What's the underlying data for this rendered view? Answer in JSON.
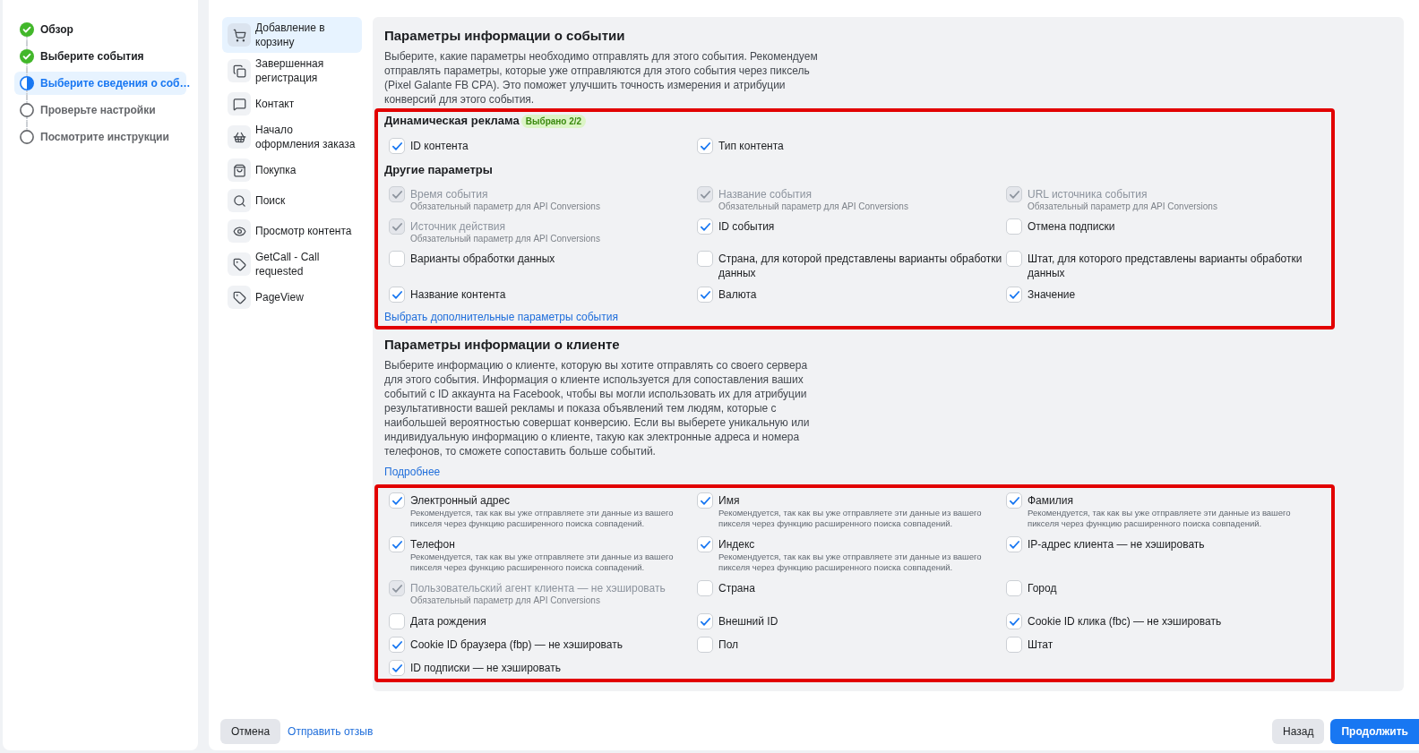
{
  "stepper": {
    "steps": [
      {
        "label": "Обзор",
        "kind": "done",
        "selected": false
      },
      {
        "label": "Выберите события",
        "kind": "done",
        "selected": false
      },
      {
        "label": "Выберите сведения о соб…",
        "kind": "current",
        "selected": true
      },
      {
        "label": "Проверьте настройки",
        "kind": "todo",
        "selected": false
      },
      {
        "label": "Посмотрите инструкции",
        "kind": "todo",
        "selected": false
      }
    ]
  },
  "events": [
    {
      "label": "Добавление в корзину",
      "selected": true
    },
    {
      "label": "Завершенная регистрация",
      "selected": false
    },
    {
      "label": "Контакт",
      "selected": false
    },
    {
      "label": "Начало оформления заказа",
      "selected": false
    },
    {
      "label": "Покупка",
      "selected": false
    },
    {
      "label": "Поиск",
      "selected": false
    },
    {
      "label": "Просмотр контента",
      "selected": false
    },
    {
      "label": "GetCall - Call requested",
      "selected": false
    },
    {
      "label": "PageView",
      "selected": false
    }
  ],
  "event_params": {
    "title": "Параметры информации о событии",
    "description": "Выберите, какие параметры необходимо отправлять для этого события. Рекомендуем отправлять параметры, которые уже отправляются для этого события через пиксель (Pixel Galante FB CPA). Это поможет улучшить точность измерения и атрибуции конверсий для этого события.",
    "highlighted": true,
    "dynamic_ads": {
      "title": "Динамическая реклама",
      "badge": "Выбрано 2/2",
      "items": [
        {
          "label": "ID контента",
          "checked": true,
          "disabled": false
        },
        {
          "label": "Тип контента",
          "checked": true,
          "disabled": false
        }
      ]
    },
    "other_params": {
      "title": "Другие параметры",
      "items": [
        {
          "label": "Время события",
          "note": "Обязательный параметр для API Conversions",
          "checked": true,
          "disabled": true
        },
        {
          "label": "Название события",
          "note": "Обязательный параметр для API Conversions",
          "checked": true,
          "disabled": true
        },
        {
          "label": "URL источника события",
          "note": "Обязательный параметр для API Conversions",
          "checked": true,
          "disabled": true
        },
        {
          "label": "Источник действия",
          "note": "Обязательный параметр для API Conversions",
          "checked": true,
          "disabled": true
        },
        {
          "label": "ID события",
          "checked": true,
          "disabled": false
        },
        {
          "label": "Отмена подписки",
          "checked": false,
          "disabled": false
        },
        {
          "label": "Варианты обработки данных",
          "checked": false,
          "disabled": false
        },
        {
          "label": "Страна, для которой представлены варианты обработки данных",
          "checked": false,
          "disabled": false
        },
        {
          "label": "Штат, для которого представлены варианты обработки данных",
          "checked": false,
          "disabled": false
        },
        {
          "label": "Название контента",
          "checked": true,
          "disabled": false
        },
        {
          "label": "Валюта",
          "checked": true,
          "disabled": false
        },
        {
          "label": "Значение",
          "checked": true,
          "disabled": false
        }
      ]
    },
    "more_link": "Выбрать дополнительные параметры события"
  },
  "customer_params": {
    "title": "Параметры информации о клиенте",
    "description": "Выберите информацию о клиенте, которую вы хотите отправлять со своего сервера для этого события. Информация о клиенте используется для сопоставления ваших событий с ID аккаунта на Facebook, чтобы вы могли использовать их для атрибуции результативности вашей рекламы и показа объявлений тем людям, которые с наибольшей вероятностью совершат конверсию. Если вы выберете уникальную или индивидуальную информацию о клиенте, такую как электронные адреса и номера телефонов, то сможете сопоставить больше событий.",
    "more_link": "Подробнее",
    "highlighted": true,
    "items": [
      {
        "label": "Электронный адрес",
        "note": "Рекомендуется, так как вы уже отправляете эти данные из вашего пикселя через функцию расширенного поиска совпадений.",
        "checked": true,
        "disabled": false
      },
      {
        "label": "Имя",
        "note": "Рекомендуется, так как вы уже отправляете эти данные из вашего пикселя через функцию расширенного поиска совпадений.",
        "checked": true,
        "disabled": false
      },
      {
        "label": "Фамилия",
        "note": "Рекомендуется, так как вы уже отправляете эти данные из вашего пикселя через функцию расширенного поиска совпадений.",
        "checked": true,
        "disabled": false
      },
      {
        "label": "Телефон",
        "note": "Рекомендуется, так как вы уже отправляете эти данные из вашего пикселя через функцию расширенного поиска совпадений.",
        "checked": true,
        "disabled": false
      },
      {
        "label": "Индекс",
        "note": "Рекомендуется, так как вы уже отправляете эти данные из вашего пикселя через функцию расширенного поиска совпадений.",
        "checked": true,
        "disabled": false
      },
      {
        "label": "IP-адрес клиента — не хэшировать",
        "checked": true,
        "disabled": false
      },
      {
        "label": "Пользовательский агент клиента — не хэшировать",
        "note": "Обязательный параметр для API Conversions",
        "checked": true,
        "disabled": true
      },
      {
        "label": "Страна",
        "checked": false,
        "disabled": false
      },
      {
        "label": "Город",
        "checked": false,
        "disabled": false
      },
      {
        "label": "Дата рождения",
        "checked": false,
        "disabled": false
      },
      {
        "label": "Внешний ID",
        "checked": true,
        "disabled": false
      },
      {
        "label": "Cookie ID клика (fbc) — не хэшировать",
        "checked": true,
        "disabled": false
      },
      {
        "label": "Cookie ID браузера (fbp) — не хэшировать",
        "checked": true,
        "disabled": false
      },
      {
        "label": "Пол",
        "checked": false,
        "disabled": false
      },
      {
        "label": "Штат",
        "checked": false,
        "disabled": false
      },
      {
        "label": "ID подписки — не хэшировать",
        "checked": true,
        "disabled": false
      }
    ]
  },
  "footer": {
    "cancel": "Отмена",
    "feedback": "Отправить отзыв",
    "back": "Назад",
    "continue": "Продолжить"
  }
}
